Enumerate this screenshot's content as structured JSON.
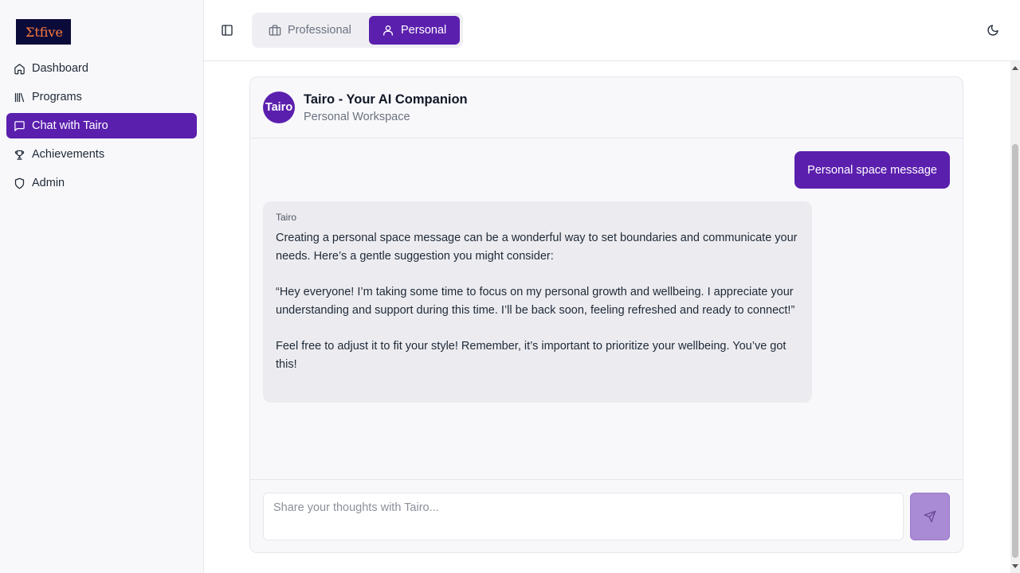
{
  "app": {
    "logo_text": "Σtfive"
  },
  "sidebar": {
    "items": [
      {
        "label": "Dashboard",
        "icon": "home-icon"
      },
      {
        "label": "Programs",
        "icon": "library-icon"
      },
      {
        "label": "Chat with Tairo",
        "icon": "message-square-icon",
        "active": true
      },
      {
        "label": "Achievements",
        "icon": "trophy-icon"
      },
      {
        "label": "Admin",
        "icon": "shield-icon"
      }
    ]
  },
  "topbar": {
    "mode_options": [
      {
        "label": "Professional",
        "icon": "briefcase-icon",
        "selected": false
      },
      {
        "label": "Personal",
        "icon": "user-icon",
        "selected": true
      }
    ],
    "theme_toggle_icon": "moon-icon"
  },
  "chat": {
    "avatar_text": "Tairo",
    "title": "Tairo - Your AI Companion",
    "subtitle": "Personal Workspace",
    "messages": [
      {
        "role": "user",
        "text": "Personal space message"
      },
      {
        "role": "assistant",
        "sender": "Tairo",
        "text": "Creating a personal space message can be a wonderful way to set boundaries and communicate your needs. Here’s a gentle suggestion you might consider:\n\n“Hey everyone! I’m taking some time to focus on my personal growth and wellbeing. I appreciate your understanding and support during this time. I’ll be back soon, feeling refreshed and ready to connect!”\n\nFeel free to adjust it to fit your style! Remember, it’s important to prioritize your wellbeing. You’ve got this!"
      }
    ],
    "input": {
      "value": "",
      "placeholder": "Share your thoughts with Tairo..."
    },
    "send_icon": "send-icon"
  },
  "colors": {
    "accent": "#5b1fae",
    "send_disabled": "#a98ad4",
    "sidebar_bg": "#f8f8fa",
    "bubble_bg": "#ececf0"
  }
}
